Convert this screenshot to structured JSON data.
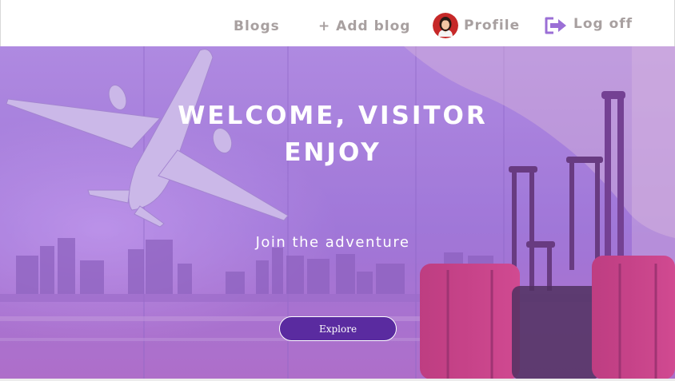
{
  "nav": {
    "blogs_label": "Blogs",
    "add_blog_label": "+ Add blog",
    "profile_label": "Profile",
    "logoff_label": "Log off"
  },
  "hero": {
    "title_line1": "WELCOME, VISITOR",
    "title_line2": "ENJOY",
    "subtitle": "Join the adventure",
    "explore_label": "Explore"
  },
  "colors": {
    "nav_text": "#a8a0a0",
    "hero_tint": "#9b6fd6",
    "button_bg": "#5a2ba0",
    "logoff_icon": "#9b6fd6"
  },
  "icons": {
    "profile": "avatar-woman",
    "logoff": "sign-out-icon"
  }
}
